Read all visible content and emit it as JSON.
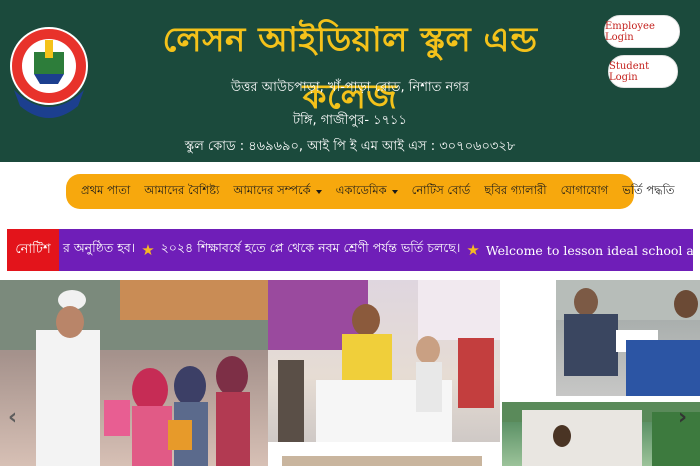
{
  "header": {
    "school_name": "লেসন আইডিয়াল স্কুল এন্ড কলেজ",
    "address": "উত্তর আউচপাড়া, খাঁ-পাড়া রোড, নিশাত নগর",
    "city": "টঙ্গি, গাজীপুর- ১৭১১",
    "codes": "স্কুল কোড : ৪৬৯৬৯০, আই পি ই এম আই এস : ৩০৭০৬০৩২৮",
    "logo": {
      "ring_text": "LESSON IDEAL SCHOOL & COLLEGE",
      "est": "Est. 2012",
      "place": "TONGI, GAZIPUR",
      "motto": "Let's your kids, study begin here"
    }
  },
  "login": {
    "employee_label": "Employee Login",
    "student_label": "Student Login"
  },
  "nav": {
    "items": [
      {
        "label": "প্রথম পাতা",
        "has_dropdown": false
      },
      {
        "label": "আমাদের বৈশিষ্ট্য",
        "has_dropdown": false
      },
      {
        "label": "আমাদের সম্পর্কে",
        "has_dropdown": true
      },
      {
        "label": "একাডেমিক",
        "has_dropdown": true
      },
      {
        "label": "নোটিস বোর্ড",
        "has_dropdown": false
      },
      {
        "label": "ছবির গ্যালারী",
        "has_dropdown": false
      },
      {
        "label": "যোগাযোগ",
        "has_dropdown": false
      },
      {
        "label": "ভর্তি পদ্ধতি",
        "has_dropdown": false
      }
    ]
  },
  "notice": {
    "label": "নোটিশ",
    "item1": "র অনুষ্ঠিত হব।",
    "item2": "২০২৪ শিক্ষাবর্ষে হতে প্লে থেকে নবম শ্রেণী পর্যন্ত ভর্তি চলছে।",
    "item3": "Welcome to lesson ideal school and college"
  },
  "gallery": {
    "prev_icon": "chevron-left-icon",
    "next_icon": "chevron-right-icon"
  },
  "colors": {
    "header_bg": "#1b4a3c",
    "title": "#f4c21a",
    "nav_bg": "#f7a80d",
    "notice_bg": "#6f1eb8",
    "notice_label_bg": "#e3141b",
    "login_text": "#c4231f"
  }
}
